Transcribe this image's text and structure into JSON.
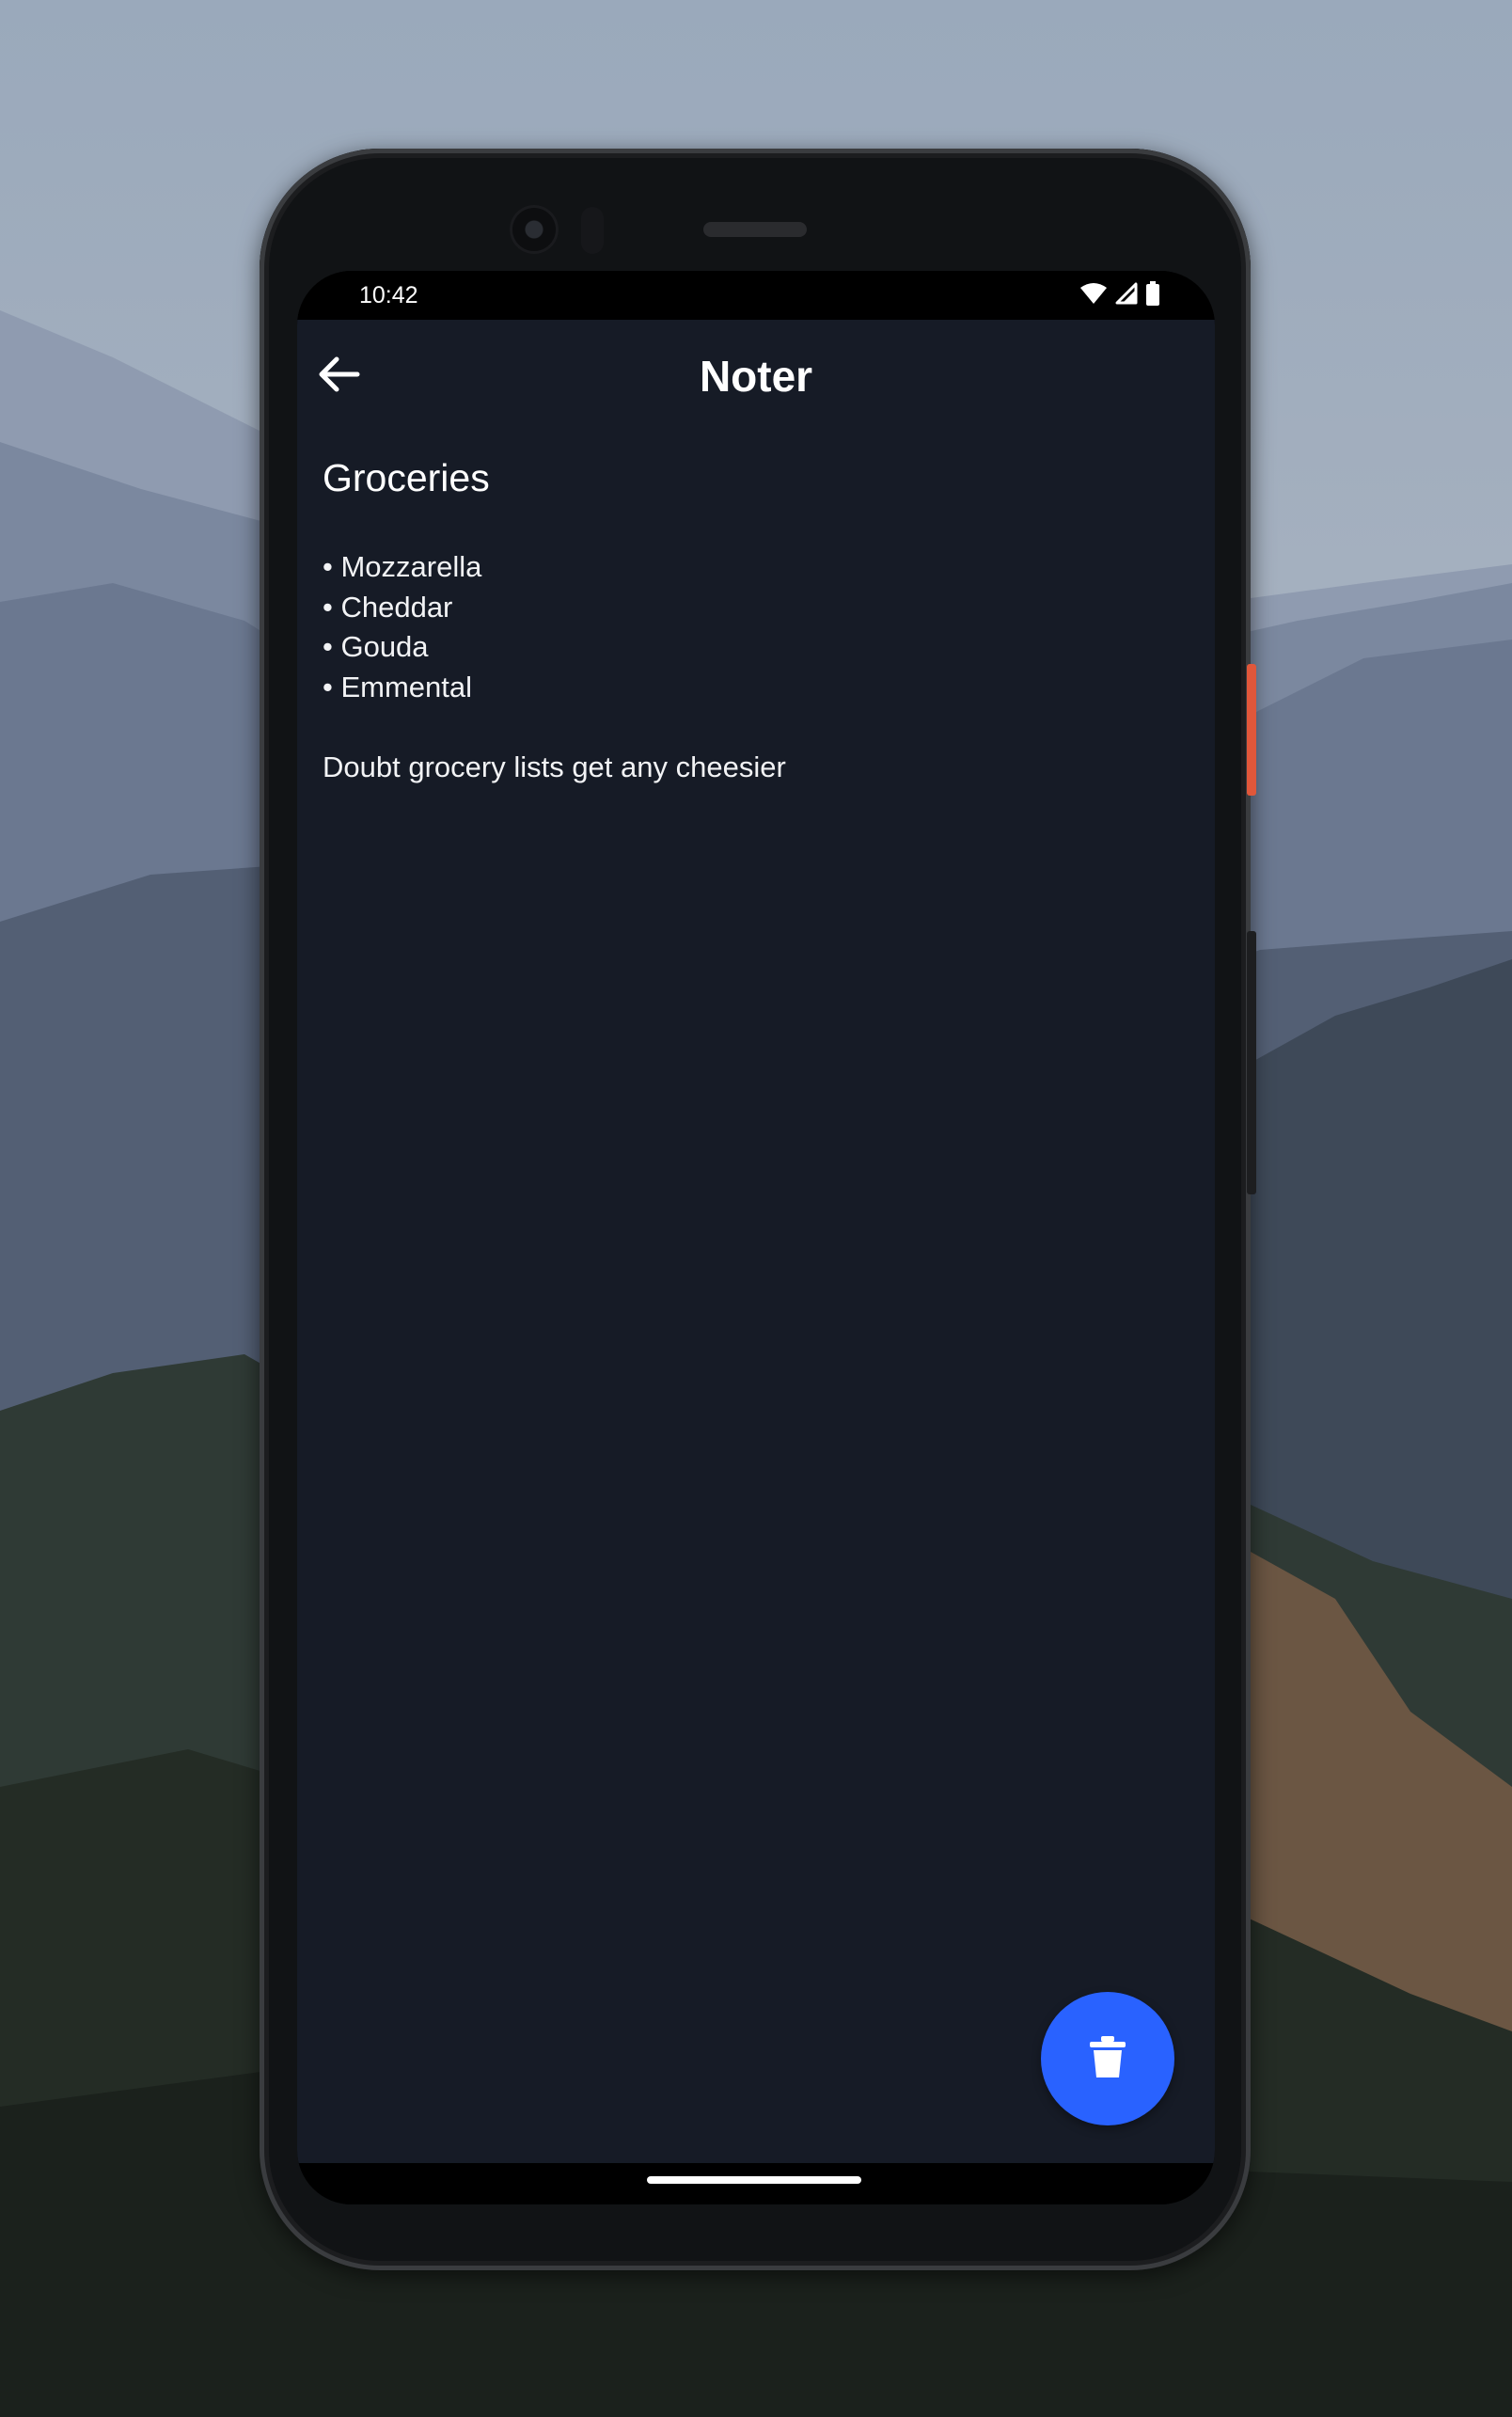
{
  "status_bar": {
    "time": "10:42",
    "icons": [
      "wifi-icon",
      "cellular-signal-icon",
      "battery-icon"
    ]
  },
  "app_bar": {
    "title": "Noter",
    "back_icon": "arrow-left-icon"
  },
  "note": {
    "title": "Groceries",
    "lines": [
      "• Mozzarella",
      "• Cheddar",
      "• Gouda",
      "• Emmental",
      "",
      "Doubt grocery lists get any cheesier"
    ]
  },
  "fab": {
    "icon": "trash-icon"
  },
  "colors": {
    "app_background": "#161b26",
    "fab_accent": "#2962ff",
    "text": "#ffffff"
  }
}
